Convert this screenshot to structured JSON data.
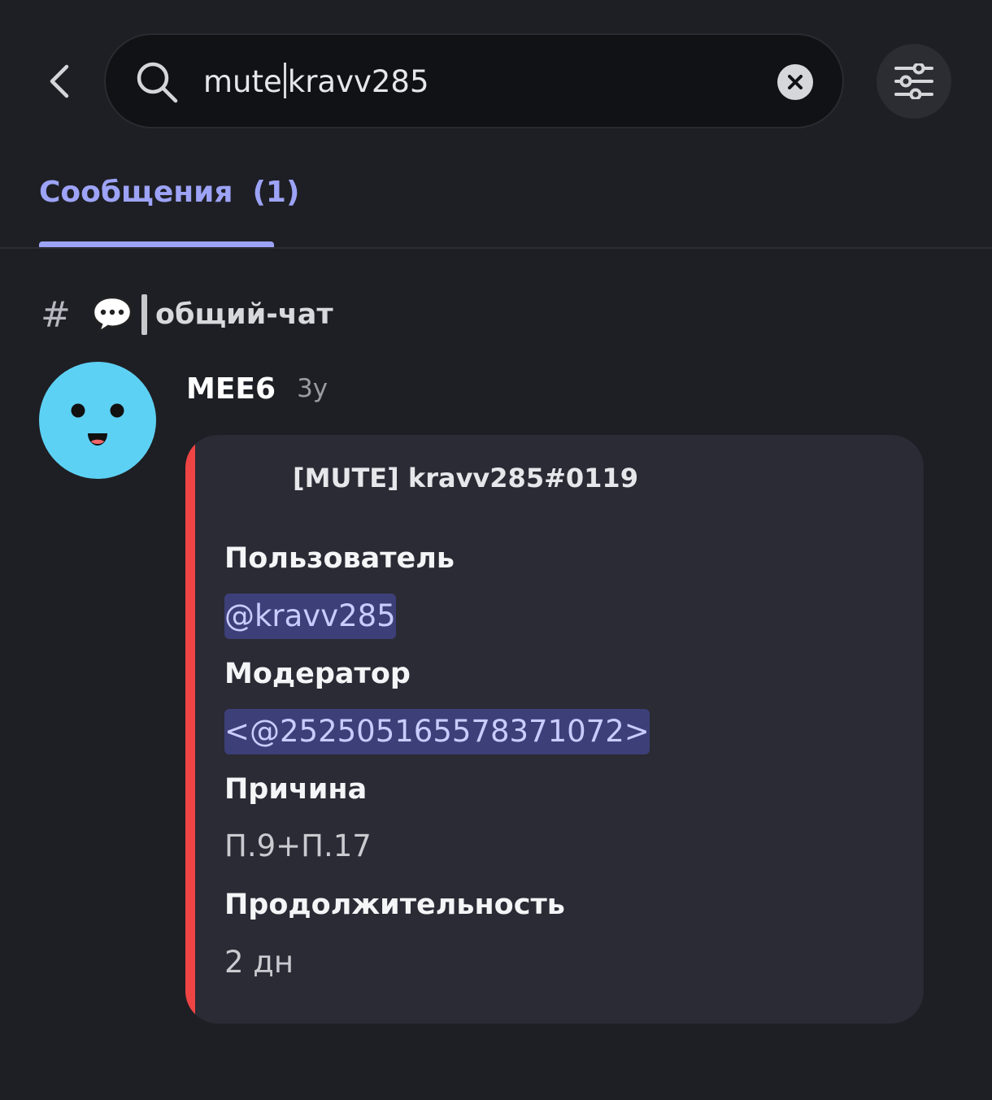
{
  "search": {
    "text_before_caret": "mute",
    "text_after_caret": "kravv285"
  },
  "tabs": [
    {
      "label": "Сообщения",
      "count": "(1)"
    }
  ],
  "channel": {
    "hash": "#",
    "name": "общий-чат"
  },
  "message": {
    "author": "MEE6",
    "timestamp": "3y",
    "embed": {
      "author": "[MUTE] kravv285#0119",
      "fields": [
        {
          "name": "Пользователь",
          "value": "@kravv285"
        },
        {
          "name": "Модератор",
          "value": "<@252505165578371072>"
        },
        {
          "name": "Причина",
          "value": "П.9+П.17"
        },
        {
          "name": "Продолжительность",
          "value": "2 дн"
        }
      ]
    }
  },
  "colors": {
    "background": "#1e1f24",
    "accent": "#9da3f6",
    "embed_bar": "#ef4444",
    "avatar": "#5dd1f4",
    "mention_bg": "#3d3f78"
  },
  "icons": {
    "back": "chevron-left-icon",
    "search": "search-icon",
    "clear": "close-icon",
    "filter": "sliders-icon",
    "channel_emoji": "speech-bubble-icon"
  }
}
